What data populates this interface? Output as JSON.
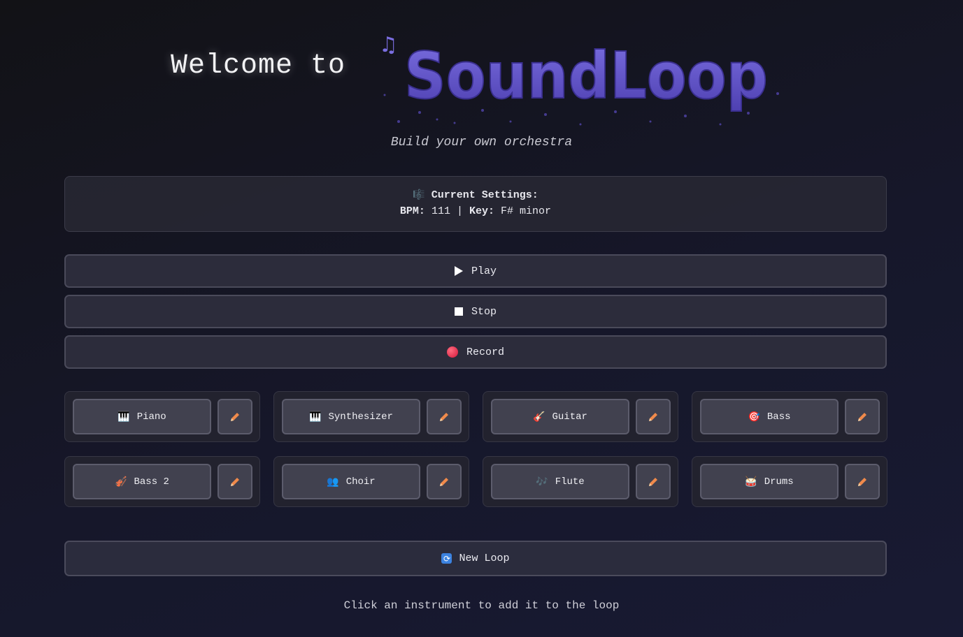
{
  "header": {
    "welcome": "Welcome to",
    "logo_text": "SoundLoop",
    "subtitle": "Build your own orchestra"
  },
  "settings": {
    "icon": "music-sheet-icon",
    "title": "Current Settings:",
    "bpm_label": "BPM:",
    "bpm_value": "111",
    "separator": "|",
    "key_label": "Key:",
    "key_value": "F# minor"
  },
  "controls": {
    "play_label": "Play",
    "stop_label": "Stop",
    "record_label": "Record"
  },
  "instruments": [
    {
      "label": "Piano",
      "icon": "🎹"
    },
    {
      "label": "Synthesizer",
      "icon": "🎹"
    },
    {
      "label": "Guitar",
      "icon": "🎸"
    },
    {
      "label": "Bass",
      "icon": "🎯"
    },
    {
      "label": "Bass 2",
      "icon": "🎻"
    },
    {
      "label": "Choir",
      "icon": "👥"
    },
    {
      "label": "Flute",
      "icon": "🎶"
    },
    {
      "label": "Drums",
      "icon": "🥁"
    }
  ],
  "new_loop_label": "New Loop",
  "hint": "Click an instrument to add it to the loop",
  "colors": {
    "logo": "#6a5fd0",
    "accent_edit": "#f08a4b",
    "record": "#d3173a"
  }
}
